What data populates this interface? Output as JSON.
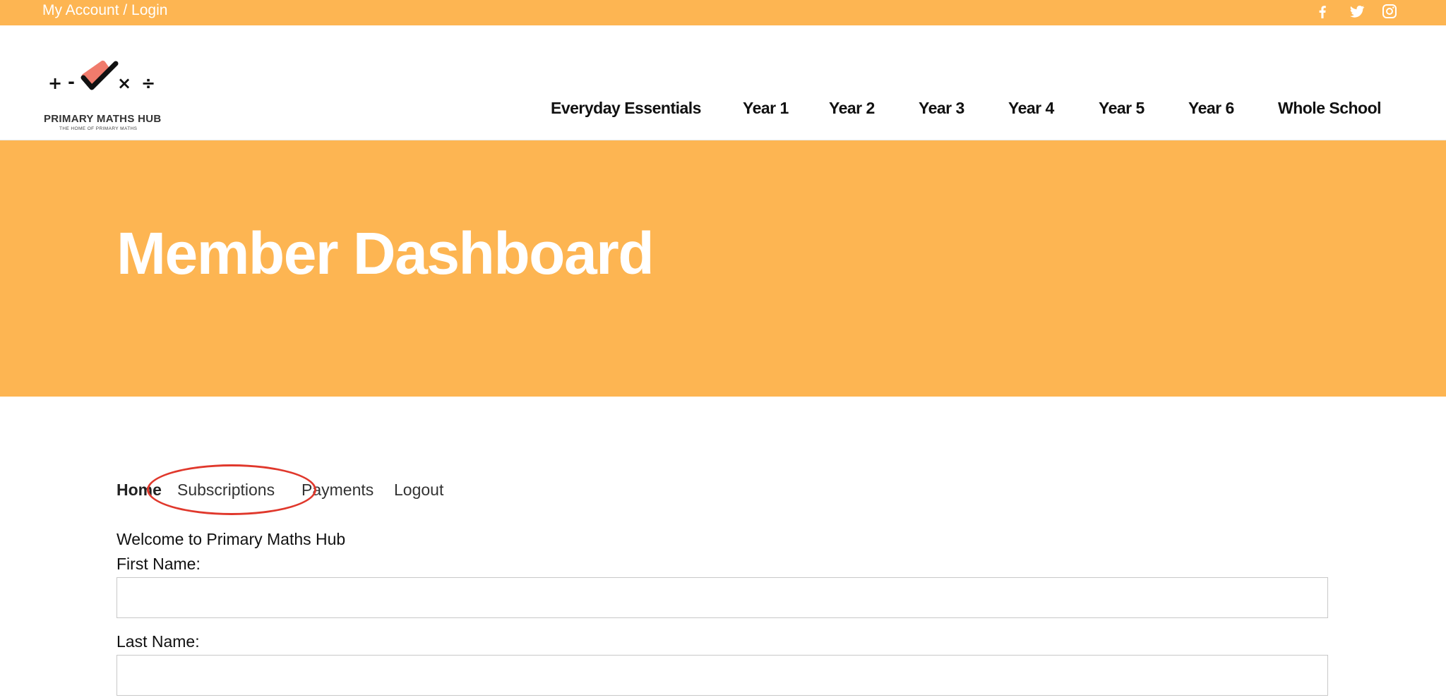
{
  "topbar": {
    "account_link": "My Account / Login",
    "social": [
      "facebook-icon",
      "twitter-icon",
      "instagram-icon"
    ]
  },
  "logo": {
    "brand": "PRIMARY MATHS HUB",
    "tagline": "THE HOME OF PRIMARY MATHS",
    "symbols": [
      "+",
      "-",
      "×",
      "÷"
    ]
  },
  "nav": {
    "items": [
      {
        "label": "Everyday Essentials"
      },
      {
        "label": "Year 1"
      },
      {
        "label": "Year 2"
      },
      {
        "label": "Year 3"
      },
      {
        "label": "Year 4"
      },
      {
        "label": "Year 5"
      },
      {
        "label": "Year 6"
      },
      {
        "label": "Whole School"
      }
    ]
  },
  "hero": {
    "title": "Member Dashboard"
  },
  "tabs": {
    "items": [
      {
        "label": "Home",
        "active": true
      },
      {
        "label": "Subscriptions",
        "active": false
      },
      {
        "label": "Payments",
        "active": false
      },
      {
        "label": "Logout",
        "active": false
      }
    ]
  },
  "form": {
    "welcome": "Welcome to Primary Maths Hub",
    "first_name_label": "First Name:",
    "first_name_value": "",
    "last_name_label": "Last Name:",
    "last_name_value": ""
  },
  "colors": {
    "brand_orange": "#fdb552",
    "annotation_red": "#e0382c",
    "logo_pink": "#f07b6c"
  }
}
